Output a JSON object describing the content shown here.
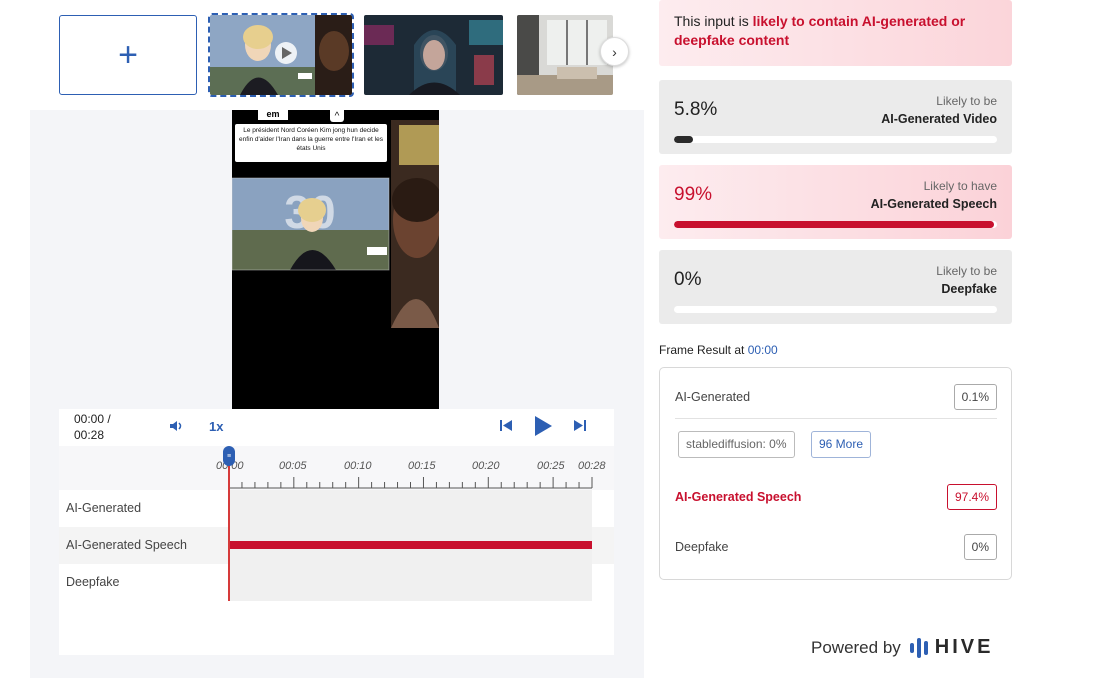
{
  "thumbnails": {
    "add_label": "+",
    "next_label": "›"
  },
  "video": {
    "caption": "Le président Nord Coréen Kim jong hun decide enfin d'aider l'Iran dans la guerre entre l'Iran et les états Unis",
    "logo_text": "em",
    "chevron": "^",
    "overlay_text": "30"
  },
  "player": {
    "time_current": "00:00 /",
    "time_total": "00:28",
    "rate": "1x",
    "ticks": [
      "00:00",
      "00:05",
      "00:10",
      "00:15",
      "00:20",
      "00:25",
      "00:28"
    ],
    "tracks": [
      {
        "label": "AI-Generated",
        "detected": 0
      },
      {
        "label": "AI-Generated Speech",
        "detected": 1
      },
      {
        "label": "Deepfake",
        "detected": 0
      }
    ]
  },
  "banner": {
    "prefix": "This input is ",
    "emphasis": "likely to contain AI-generated or deepfake content"
  },
  "cards": [
    {
      "pct": "5.8%",
      "value": 0.058,
      "line1": "Likely to be",
      "line2": "AI-Generated Video",
      "alert": false
    },
    {
      "pct": "99%",
      "value": 0.99,
      "line1": "Likely to have",
      "line2": "AI-Generated Speech",
      "alert": true
    },
    {
      "pct": "0%",
      "value": 0.0,
      "line1": "Likely to be",
      "line2": "Deepfake",
      "alert": false
    }
  ],
  "frame_result": {
    "title": "Frame Result at ",
    "time": "00:00",
    "ai_generated_label": "AI-Generated",
    "ai_generated_value": "0.1%",
    "chip_label": "stablediffusion: 0%",
    "more_label": "96 More",
    "speech_label": "AI-Generated Speech",
    "speech_value": "97.4%",
    "deepfake_label": "Deepfake",
    "deepfake_value": "0%"
  },
  "footer": {
    "powered_by": "Powered by",
    "brand": "HIVE"
  },
  "colors": {
    "accent": "#2d5fb3",
    "alert": "#c8102e"
  }
}
